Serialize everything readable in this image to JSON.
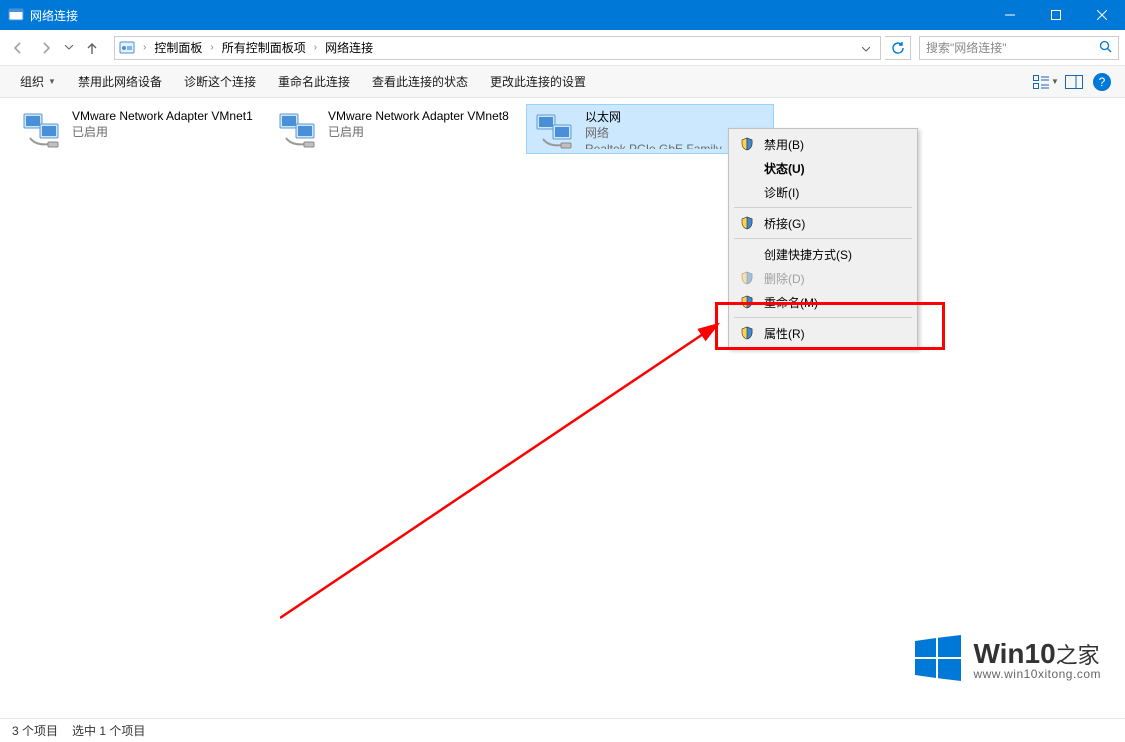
{
  "window": {
    "title": "网络连接"
  },
  "nav": {
    "breadcrumb": [
      "控制面板",
      "所有控制面板项",
      "网络连接"
    ],
    "search_placeholder": "搜索\"网络连接\""
  },
  "toolbar": {
    "organize": "组织",
    "disable": "禁用此网络设备",
    "diagnose": "诊断这个连接",
    "rename": "重命名此连接",
    "view_status": "查看此连接的状态",
    "change_settings": "更改此连接的设置"
  },
  "adapters": [
    {
      "name": "VMware Network Adapter VMnet1",
      "status": "已启用",
      "detail": ""
    },
    {
      "name": "VMware Network Adapter VMnet8",
      "status": "已启用",
      "detail": ""
    },
    {
      "name": "以太网",
      "status": "网络",
      "detail": "Realtek PCIe GbE Family ..."
    }
  ],
  "context_menu": {
    "items": [
      {
        "label": "禁用(B)",
        "shield": true
      },
      {
        "label": "状态(U)",
        "bold": true
      },
      {
        "label": "诊断(I)"
      },
      {
        "sep": true
      },
      {
        "label": "桥接(G)",
        "shield": true
      },
      {
        "sep": true
      },
      {
        "label": "创建快捷方式(S)"
      },
      {
        "label": "删除(D)",
        "shield": true,
        "disabled": true
      },
      {
        "label": "重命名(M)",
        "shield": true
      },
      {
        "sep": true
      },
      {
        "label": "属性(R)",
        "shield": true
      }
    ]
  },
  "statusbar": {
    "count": "3 个项目",
    "selected": "选中 1 个项目"
  },
  "watermark": {
    "brand": "Win10",
    "suffix": "之家",
    "url": "www.win10xitong.com"
  }
}
